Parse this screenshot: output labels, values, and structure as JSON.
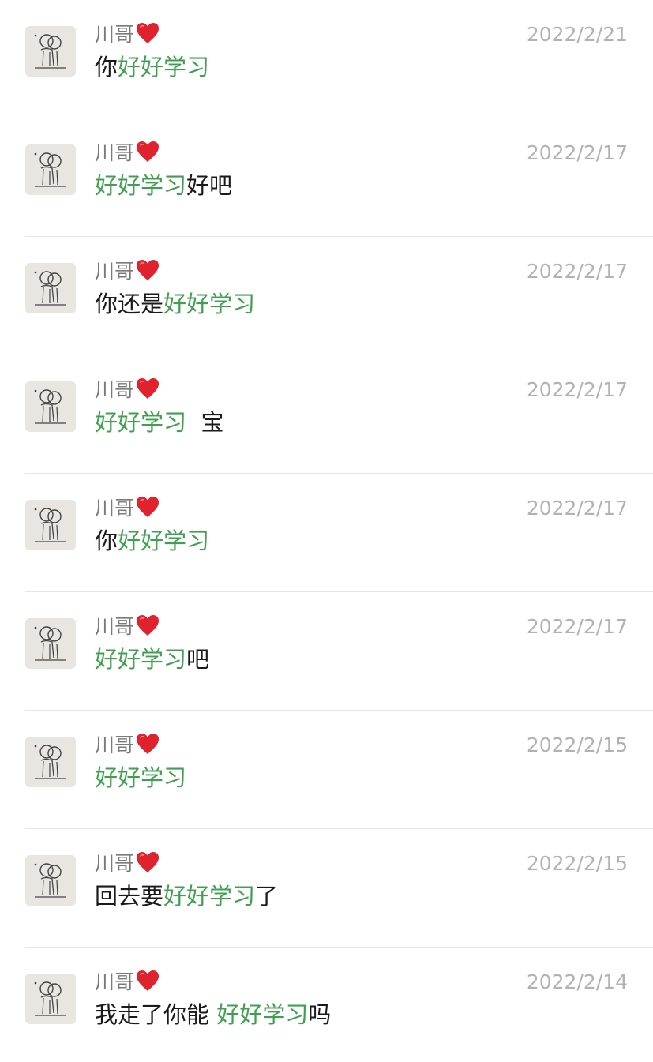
{
  "colors": {
    "name": "#7a7a7a",
    "date": "#b2b2b2",
    "text": "#1a1a1a",
    "highlight": "#3fa14f",
    "heart": "#e0212e",
    "divider": "#e5e5e5"
  },
  "results": [
    {
      "sender": "川哥",
      "heart_icon": "heart-emoji",
      "date": "2022/2/21",
      "msg_before": "你",
      "msg_highlight": "好好学习",
      "msg_after": ""
    },
    {
      "sender": "川哥",
      "heart_icon": "heart-emoji",
      "date": "2022/2/17",
      "msg_before": "",
      "msg_highlight": "好好学习",
      "msg_after": "好吧"
    },
    {
      "sender": "川哥",
      "heart_icon": "heart-emoji",
      "date": "2022/2/17",
      "msg_before": "你还是",
      "msg_highlight": "好好学习",
      "msg_after": ""
    },
    {
      "sender": "川哥",
      "heart_icon": "heart-emoji",
      "date": "2022/2/17",
      "msg_before": "",
      "msg_highlight": "好好学习",
      "msg_after": "  宝"
    },
    {
      "sender": "川哥",
      "heart_icon": "heart-emoji",
      "date": "2022/2/17",
      "msg_before": "你",
      "msg_highlight": "好好学习",
      "msg_after": ""
    },
    {
      "sender": "川哥",
      "heart_icon": "heart-emoji",
      "date": "2022/2/17",
      "msg_before": "",
      "msg_highlight": "好好学习",
      "msg_after": "吧"
    },
    {
      "sender": "川哥",
      "heart_icon": "heart-emoji",
      "date": "2022/2/15",
      "msg_before": "",
      "msg_highlight": "好好学习",
      "msg_after": ""
    },
    {
      "sender": "川哥",
      "heart_icon": "heart-emoji",
      "date": "2022/2/15",
      "msg_before": "回去要",
      "msg_highlight": "好好学习",
      "msg_after": "了"
    },
    {
      "sender": "川哥",
      "heart_icon": "heart-emoji",
      "date": "2022/2/14",
      "msg_before": "我走了你能 ",
      "msg_highlight": "好好学习",
      "msg_after": "吗"
    }
  ]
}
